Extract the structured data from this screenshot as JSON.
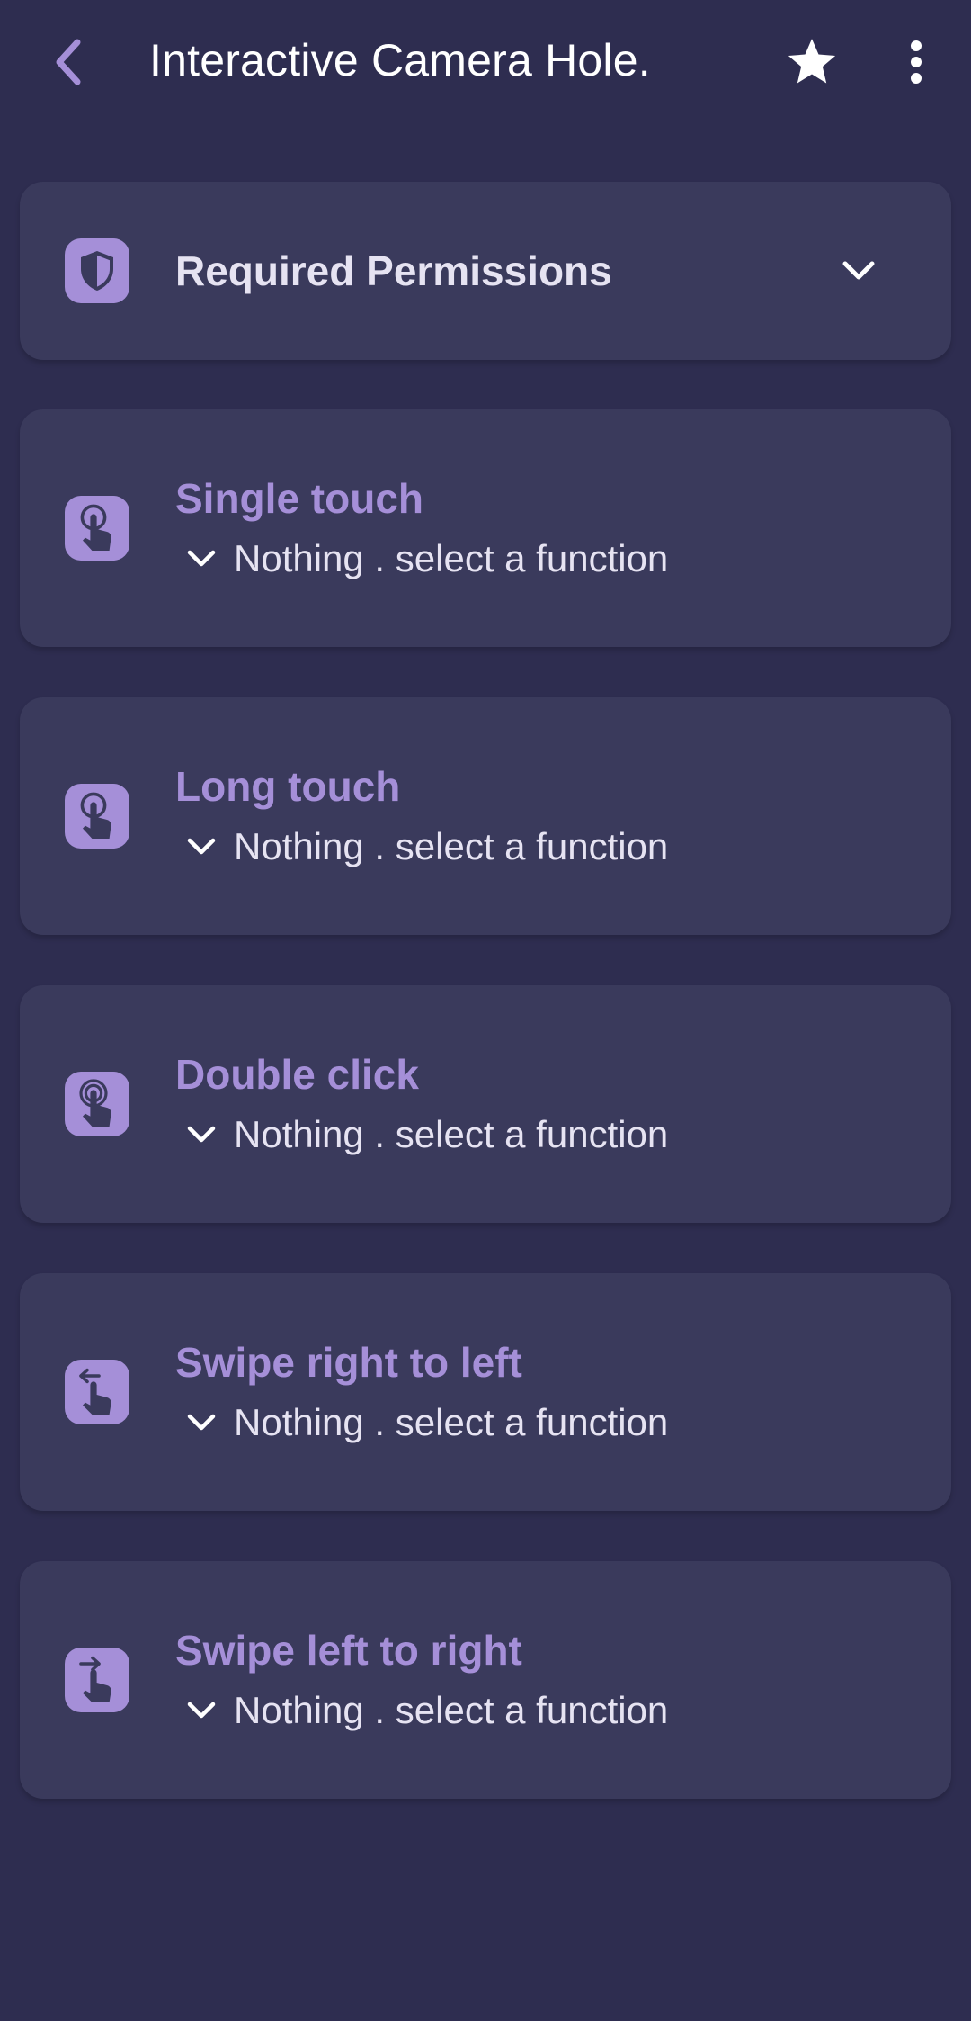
{
  "appbar": {
    "title": "Interactive Camera Hole.",
    "back_icon": "back-arrow-icon",
    "star_icon": "star-icon",
    "more_icon": "more-vert-icon"
  },
  "permissions": {
    "title": "Required Permissions",
    "icon": "shield-icon",
    "expand_icon": "chevron-down-icon"
  },
  "gestures": [
    {
      "title": "Single touch",
      "value": "Nothing . select a function",
      "icon": "single-touch-icon"
    },
    {
      "title": "Long touch",
      "value": "Nothing . select a function",
      "icon": "long-touch-icon"
    },
    {
      "title": "Double click",
      "value": "Nothing . select a function",
      "icon": "double-click-icon"
    },
    {
      "title": "Swipe right to left",
      "value": "Nothing . select a function",
      "icon": "swipe-left-icon"
    },
    {
      "title": "Swipe left to right",
      "value": "Nothing . select a function",
      "icon": "swipe-right-icon"
    }
  ],
  "colors": {
    "background": "#2e2d50",
    "card": "#3a3a5c",
    "accent": "#a58fd8",
    "text": "#e6e3f2"
  }
}
